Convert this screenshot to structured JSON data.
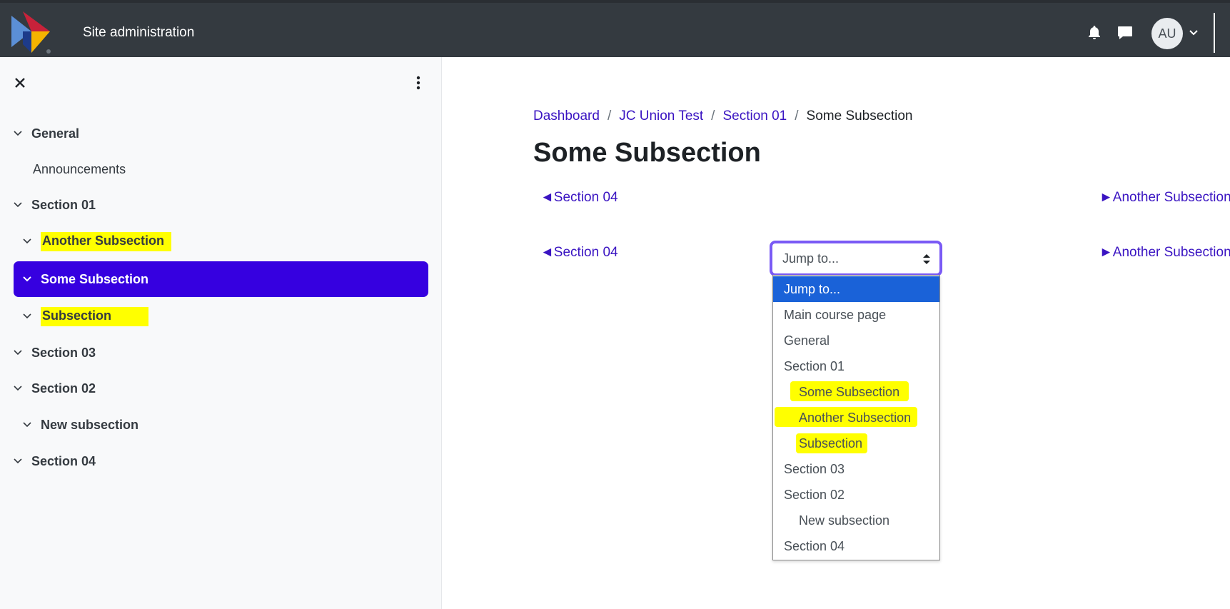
{
  "header": {
    "site_title": "Site administration",
    "avatar_initials": "AU",
    "icons": [
      "logo",
      "bell-icon",
      "chat-icon",
      "chevron-down-icon"
    ]
  },
  "drawer": {
    "items": [
      {
        "label": "General",
        "level": 0,
        "bold": true,
        "expanded": true
      },
      {
        "label": "Announcements",
        "level": 1,
        "bold": false
      },
      {
        "label": "Section 01",
        "level": 0,
        "bold": true,
        "expanded": true
      },
      {
        "label": "Another Subsection",
        "level": 1,
        "bold": true,
        "highlighted": true
      },
      {
        "label": "Some Subsection",
        "level": 1,
        "bold": true,
        "active": true
      },
      {
        "label": "Subsection",
        "level": 1,
        "bold": true,
        "highlighted": true
      },
      {
        "label": "Section 03",
        "level": 0,
        "bold": true
      },
      {
        "label": "Section 02",
        "level": 0,
        "bold": true
      },
      {
        "label": "New subsection",
        "level": 1,
        "bold": true
      },
      {
        "label": "Section 04",
        "level": 0,
        "bold": true
      }
    ]
  },
  "breadcrumb": {
    "items": [
      "Dashboard",
      "JC Union Test",
      "Section 01"
    ],
    "current": "Some Subsection",
    "separator": "/"
  },
  "main": {
    "title": "Some Subsection",
    "prev_link": "◄Section 04",
    "next_link": "►Another Subsection",
    "jump_select_value": "Jump to...",
    "jump_options": [
      {
        "label": "Jump to...",
        "selected": true
      },
      {
        "label": "Main course page"
      },
      {
        "label": "General"
      },
      {
        "label": "Section 01"
      },
      {
        "label": "Some Subsection",
        "indent": true,
        "highlighted": true
      },
      {
        "label": "Another Subsection",
        "indent": true,
        "highlighted": true
      },
      {
        "label": "Subsection",
        "indent": true,
        "highlighted": true
      },
      {
        "label": "Section 03"
      },
      {
        "label": "Section 02"
      },
      {
        "label": "New subsection",
        "indent": true
      },
      {
        "label": "Section 04"
      }
    ]
  },
  "colors": {
    "navbar": "#343a40",
    "accent": "#3600e0",
    "link": "#3a14c2",
    "highlight": "#ffff00",
    "dropdown_selected": "#1a62d8"
  }
}
